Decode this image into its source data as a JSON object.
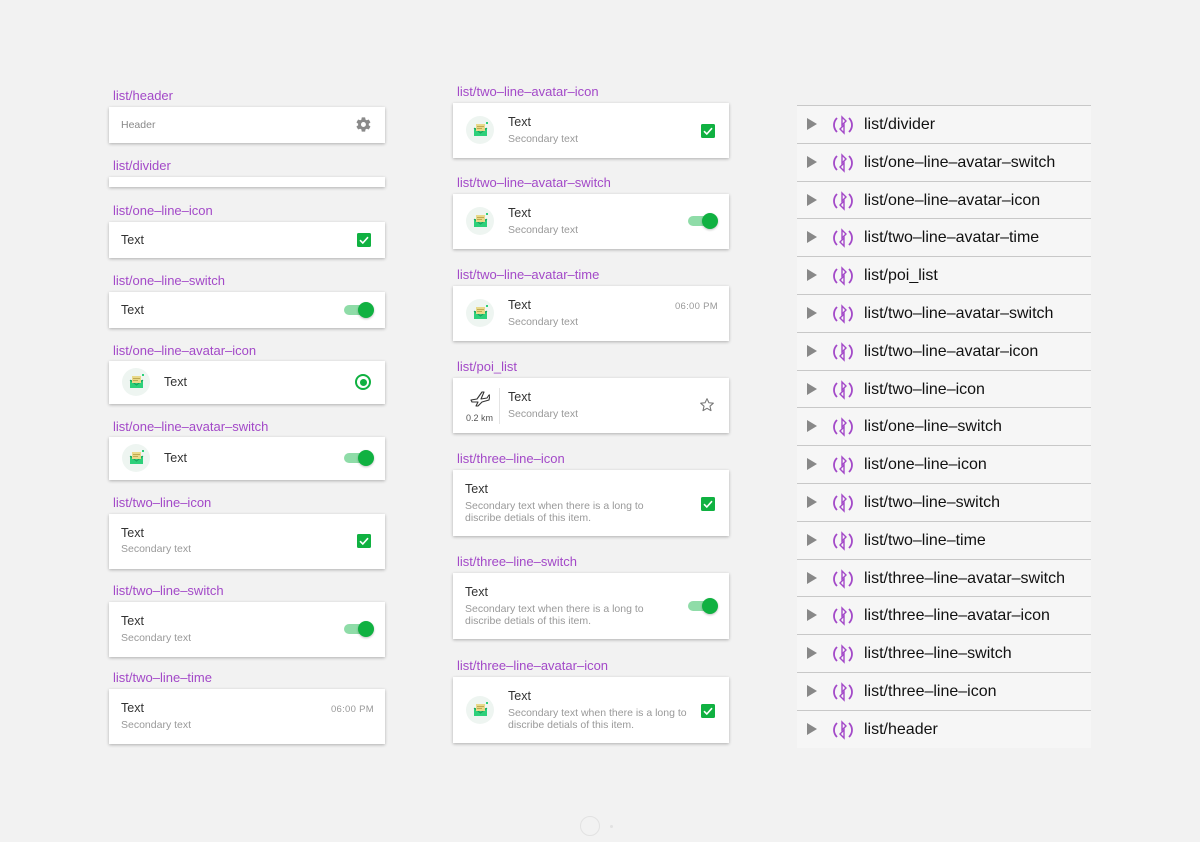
{
  "col1": {
    "header": {
      "label": "list/header",
      "text": "Header"
    },
    "divider": {
      "label": "list/divider"
    },
    "one_line_icon": {
      "label": "list/one–line–icon",
      "text": "Text"
    },
    "one_line_switch": {
      "label": "list/one–line–switch",
      "text": "Text"
    },
    "one_line_avatar_icon": {
      "label": "list/one–line–avatar–icon",
      "text": "Text"
    },
    "one_line_avatar_switch": {
      "label": "list/one–line–avatar–switch",
      "text": "Text"
    },
    "two_line_icon": {
      "label": "list/two–line–icon",
      "text": "Text",
      "secondary": "Secondary text"
    },
    "two_line_switch": {
      "label": "list/two–line–switch",
      "text": "Text",
      "secondary": "Secondary text"
    },
    "two_line_time": {
      "label": "list/two–line–time",
      "text": "Text",
      "secondary": "Secondary text",
      "time": "06:00 PM"
    }
  },
  "col2": {
    "two_line_avatar_icon": {
      "label": "list/two–line–avatar–icon",
      "text": "Text",
      "secondary": "Secondary text"
    },
    "two_line_avatar_switch": {
      "label": "list/two–line–avatar–switch",
      "text": "Text",
      "secondary": "Secondary text"
    },
    "two_line_avatar_time": {
      "label": "list/two–line–avatar–time",
      "text": "Text",
      "secondary": "Secondary text",
      "time": "06:00 PM"
    },
    "poi_list": {
      "label": "list/poi_list",
      "text": "Text",
      "secondary": "Secondary text",
      "distance": "0.2 km"
    },
    "three_line_icon": {
      "label": "list/three–line–icon",
      "text": "Text",
      "secondary": "Secondary text when there is a long to discribe detials of this item."
    },
    "three_line_switch": {
      "label": "list/three–line–switch",
      "text": "Text",
      "secondary": "Secondary text when there is a long  to discribe detials of this item."
    },
    "three_line_avatar_icon": {
      "label": "list/three–line–avatar–icon",
      "text": "Text",
      "secondary": "Secondary text when there is a long to discribe detials of this item."
    }
  },
  "layers": [
    "list/divider",
    "list/one–line–avatar–switch",
    "list/one–line–avatar–icon",
    "list/two–line–avatar–time",
    "list/poi_list",
    "list/two–line–avatar–switch",
    "list/two–line–avatar–icon",
    "list/two–line–icon",
    "list/one–line–switch",
    "list/one–line–icon",
    "list/two–line–switch",
    "list/two–line–time",
    "list/three–line–avatar–switch",
    "list/three–line–avatar–icon",
    "list/three–line–switch",
    "list/three–line–icon",
    "list/header"
  ],
  "colors": {
    "label": "#a349c8",
    "accent_green": "#10b141",
    "symbol_purple": "#a349c8"
  },
  "icons": {
    "header": "gear-icon",
    "check": "checkbox-checked-icon",
    "toggle": "toggle-on-icon",
    "radio": "radio-selected-icon",
    "avatar": "mail-avatar-icon",
    "poi": "airplane-icon",
    "favorite": "star-outline-icon",
    "layer_toggle": "disclosure-triangle-icon",
    "layer_type": "symbol-instance-icon"
  }
}
